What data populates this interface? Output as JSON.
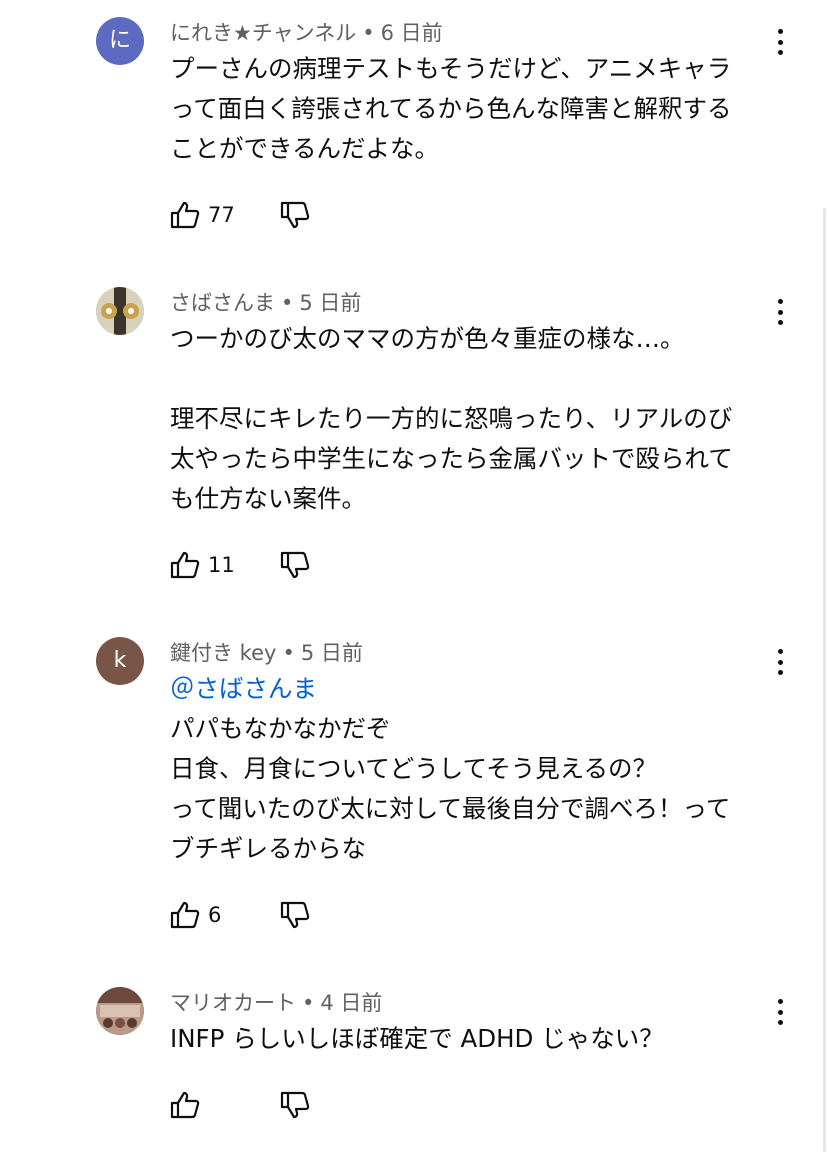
{
  "comments": [
    {
      "author": "にれき★チャンネル",
      "time": "6 日前",
      "avatar_letter": "に",
      "avatar_color": "#5c6bc0",
      "lines": [
        "プーさんの病理テストもそうだけど、アニメキャラ",
        "って面白く誇張されてるから色んな障害と解釈する",
        "ことができるんだよな。"
      ],
      "likes": "77"
    },
    {
      "author": "さばさんま",
      "time": "5 日前",
      "avatar_color": "#c9c2a8",
      "lines": [
        "つーかのび太のママの方が色々重症の様な…。",
        "",
        "理不尽にキレたり一方的に怒鳴ったり、リアルのび",
        "太やったら中学生になったら金属バットで殴られて",
        "も仕方ない案件。"
      ],
      "likes": "11"
    },
    {
      "author": "鍵付き key",
      "time": "5 日前",
      "avatar_letter": "k",
      "avatar_color": "#795548",
      "mention": "＠さばさんま",
      "lines": [
        "パパもなかなかだぞ",
        "日食、月食についてどうしてそう見えるの？",
        "って聞いたのび太に対して最後自分で調べろ！って",
        "ブチギレるからな"
      ],
      "likes": "6"
    },
    {
      "author": "マリオカート",
      "time": "4 日前",
      "avatar_color": "#8a6a5a",
      "lines": [
        "INFP らしいしほぼ確定で ADHD じゃない？"
      ],
      "likes": ""
    }
  ],
  "separator": "•",
  "icons": {
    "like": "thumbs-up-icon",
    "dislike": "thumbs-down-icon",
    "more": "more-vertical-icon"
  }
}
